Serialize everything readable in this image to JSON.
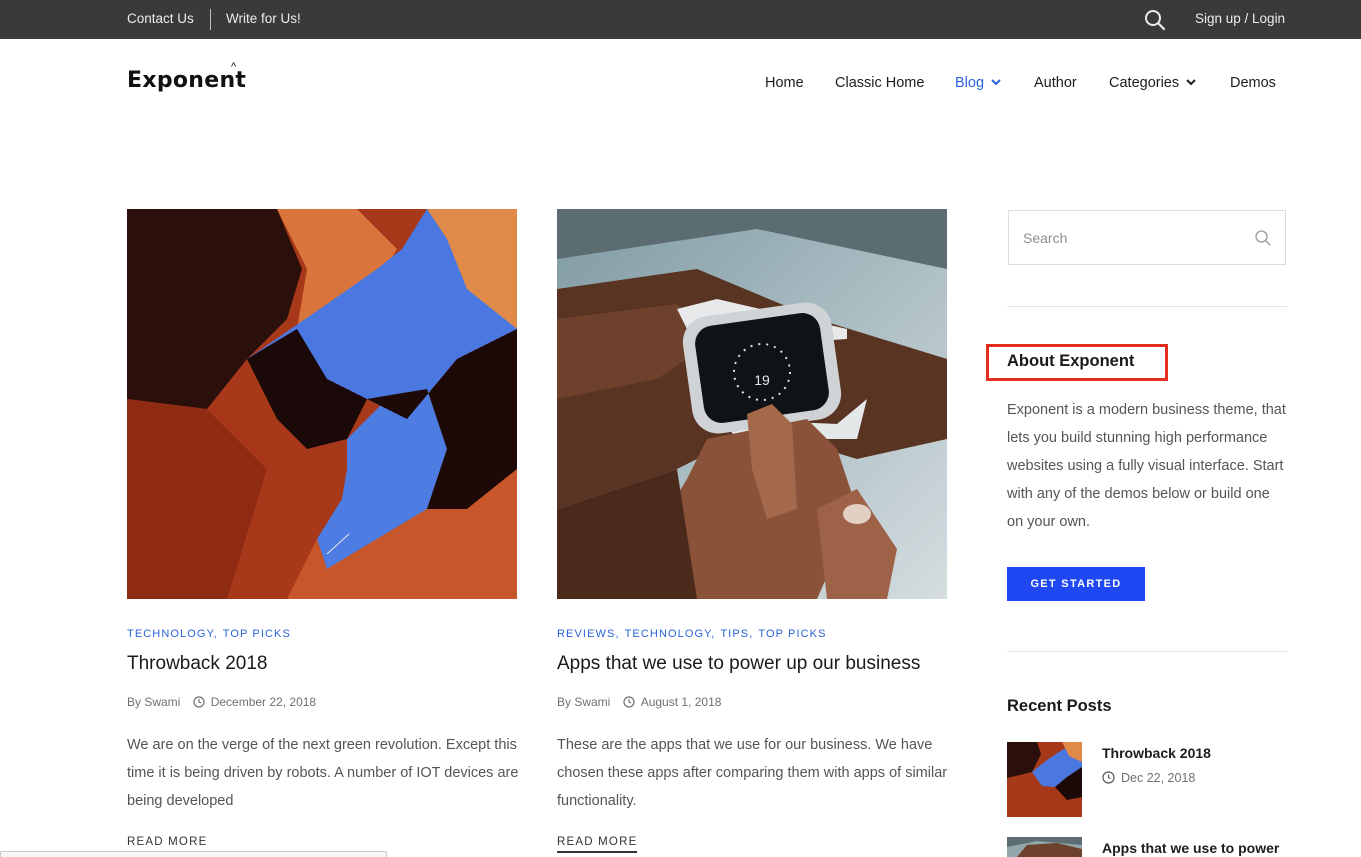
{
  "topbar": {
    "contact_label": "Contact Us",
    "write_label": "Write for Us!",
    "signup_label": "Sign up / Login"
  },
  "header": {
    "logo_text": "Exponent",
    "nav": {
      "home": "Home",
      "classic_home": "Classic Home",
      "blog": "Blog",
      "author": "Author",
      "categories": "Categories",
      "demos": "Demos"
    },
    "active_color": "#2b62d9"
  },
  "posts": [
    {
      "categories": [
        "TECHNOLOGY",
        "TOP PICKS"
      ],
      "title": "Throwback 2018",
      "author": "By Swami",
      "date": "December 22, 2018",
      "excerpt": "We are on the verge of the next green revolution. Except this time it is being driven by robots. A number of IOT devices are being developed",
      "read_more": "READ MORE"
    },
    {
      "categories": [
        "REVIEWS",
        "TECHNOLOGY",
        "TIPS",
        "TOP PICKS"
      ],
      "title": "Apps that we use to power up our business",
      "author": "By Swami",
      "date": "August 1, 2018",
      "excerpt": "These are the apps that we use for our business. We have chosen these apps after comparing them with apps of similar functionality.",
      "read_more": "READ MORE"
    }
  ],
  "sidebar": {
    "search_placeholder": "Search",
    "about_title": "About Exponent",
    "about_text": "Exponent is a modern business theme, that lets you build stunning high performance websites using a fully visual interface. Start with any of the demos below or build one on your own.",
    "cta_label": "GET STARTED",
    "recent_title": "Recent Posts",
    "recent": [
      {
        "title": "Throwback 2018",
        "date": "Dec 22, 2018"
      },
      {
        "title": "Apps that we use to power"
      }
    ]
  },
  "colors": {
    "accent": "#2b62d9",
    "button": "#1f47f2",
    "highlight": "#e32d20",
    "topbar": "#3a3a3a"
  }
}
